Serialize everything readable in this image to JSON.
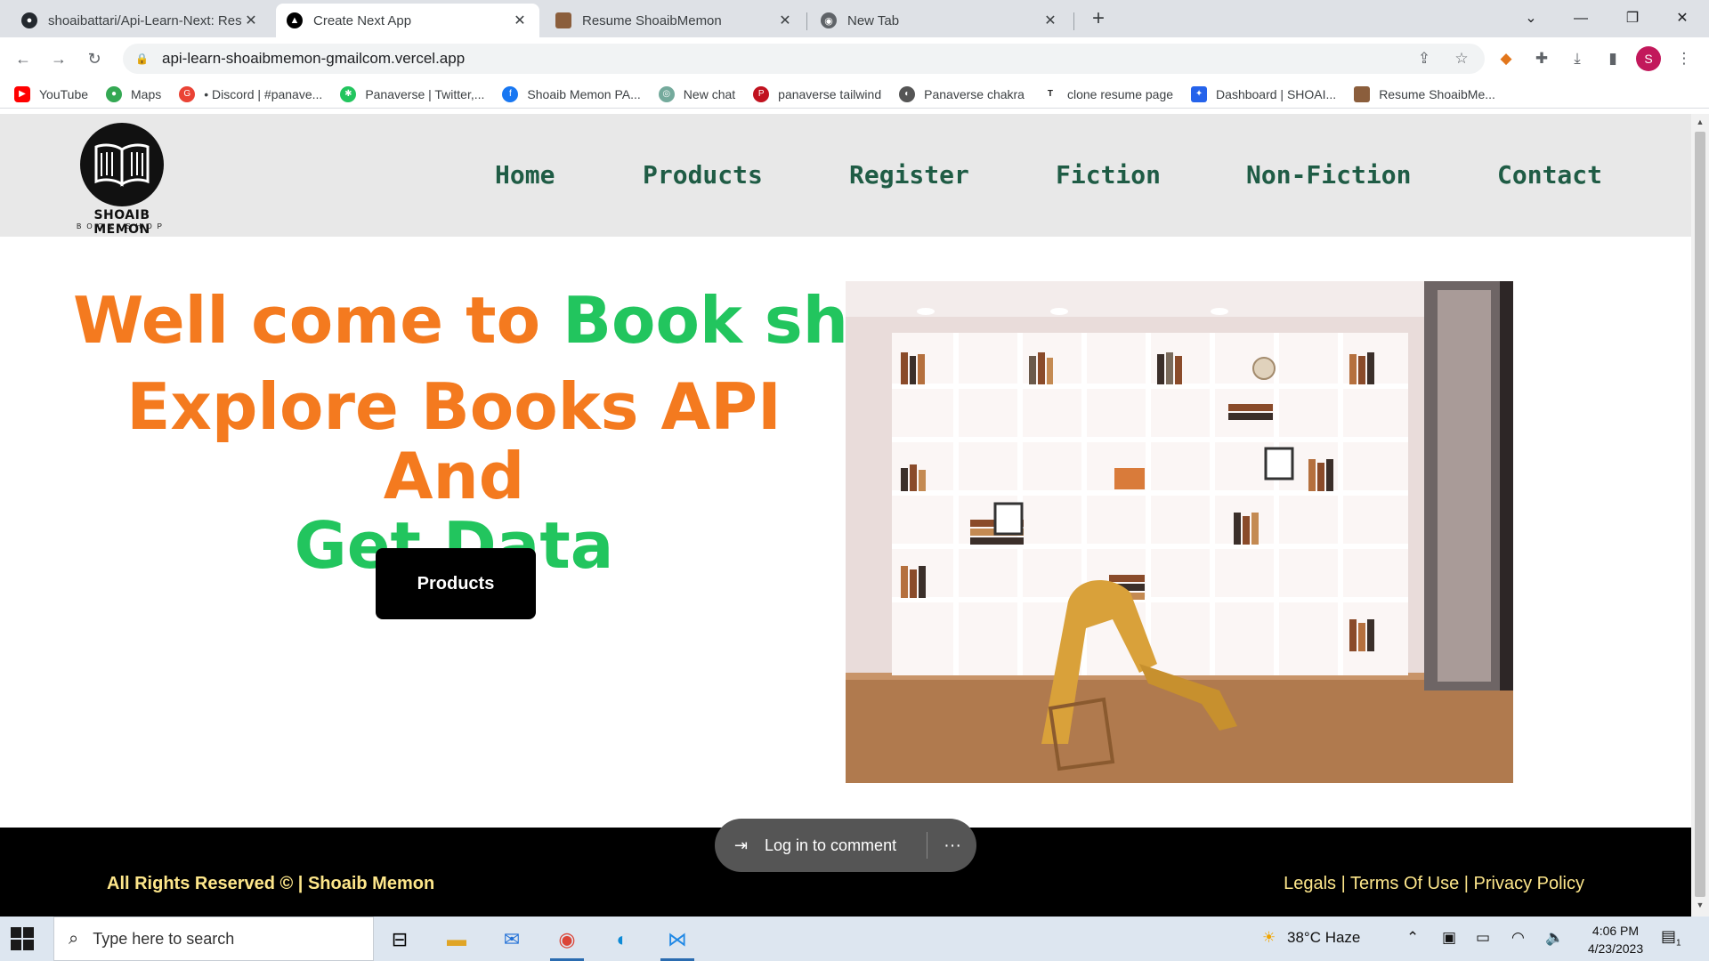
{
  "browser": {
    "tabs": [
      {
        "title": "shoaibattari/Api-Learn-Next: Rest",
        "icon": "github-icon",
        "active": false
      },
      {
        "title": "Create Next App",
        "icon": "vercel-icon",
        "active": true
      },
      {
        "title": "Resume ShoaibMemon",
        "icon": "site-favicon-icon",
        "active": false
      },
      {
        "title": "New Tab",
        "icon": "chrome-icon",
        "active": false
      }
    ],
    "url": "api-learn-shoaibmemon-gmailcom.vercel.app",
    "profile_initial": "S",
    "bookmarks": [
      {
        "label": "YouTube",
        "color": "#ff0000"
      },
      {
        "label": "Maps",
        "color": "#34a853"
      },
      {
        "label": "• Discord | #panave...",
        "color": "#ea4335"
      },
      {
        "label": "Panaverse | Twitter,...",
        "color": "#22c55e"
      },
      {
        "label": "Shoaib Memon PA...",
        "color": "#1877f2"
      },
      {
        "label": "New chat",
        "color": "#74aa9c"
      },
      {
        "label": "panaverse tailwind",
        "color": "#c1121f"
      },
      {
        "label": "Panaverse chakra",
        "color": "#555555"
      },
      {
        "label": "clone resume page",
        "color": "#222222"
      },
      {
        "label": "Dashboard | SHOAI...",
        "color": "#2563eb"
      },
      {
        "label": "Resume ShoaibMe...",
        "color": "#8b5e3c"
      }
    ]
  },
  "site": {
    "logo": {
      "name": "SHOAIB MEMON",
      "sub": "BOOK SHOP"
    },
    "nav": [
      "Home",
      "Products",
      "Register",
      "Fiction",
      "Non-Fiction",
      "Contact"
    ],
    "hero": {
      "line1_a": "Well come to",
      "line1_b": "Book shop",
      "line2_a": "Explore Books API And",
      "line2_b": "Get Data",
      "button": "Products"
    },
    "footer": {
      "left": "All Rights Reserved © | Shoaib Memon",
      "right": "Legals | Terms Of Use | Privacy Policy"
    },
    "comment_pill": {
      "label": "Log in to comment",
      "more": "···"
    }
  },
  "colors": {
    "orange": "#f47a1f",
    "green": "#22c55e",
    "nav": "#1f5c45",
    "footer_text": "#fde68a"
  },
  "taskbar": {
    "search_placeholder": "Type here to search",
    "weather": "38°C  Haze",
    "time": "4:06 PM",
    "date": "4/23/2023",
    "notifications": "1"
  }
}
